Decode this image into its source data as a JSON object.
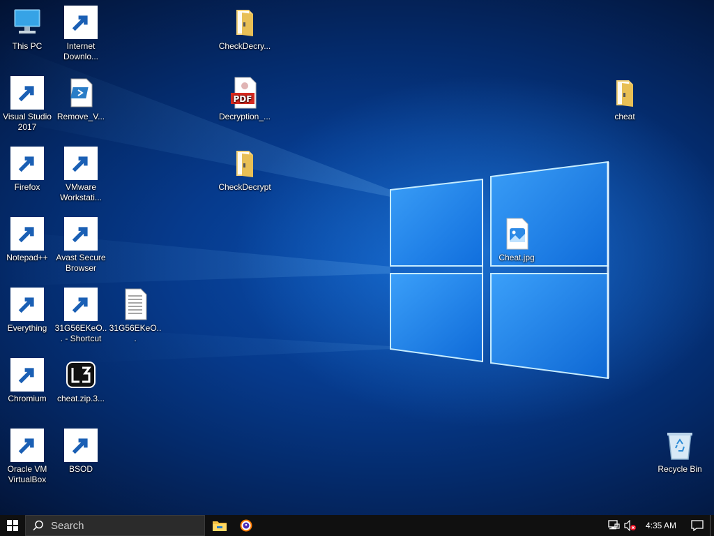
{
  "desktop_icons": [
    {
      "label": "This PC",
      "icon": "this-pc-icon"
    },
    {
      "label": "Internet Downlo...",
      "icon": "internet-download-manager-icon",
      "shortcut": true
    },
    {
      "label": "CheckDecry...",
      "icon": "folder-icon"
    },
    {
      "label": "Visual Studio 2017",
      "icon": "visual-studio-icon",
      "shortcut": true
    },
    {
      "label": "Remove_V...",
      "icon": "powershell-script-icon"
    },
    {
      "label": "Decryption_...",
      "icon": "pdf-icon",
      "badge": "PDF"
    },
    {
      "label": "cheat",
      "icon": "folder-icon"
    },
    {
      "label": "Firefox",
      "icon": "firefox-icon",
      "shortcut": true
    },
    {
      "label": "VMware Workstati...",
      "icon": "vmware-icon",
      "shortcut": true
    },
    {
      "label": "CheckDecrypt",
      "icon": "folder-icon"
    },
    {
      "label": "Notepad++",
      "icon": "notepad-plus-plus-icon",
      "shortcut": true
    },
    {
      "label": "Avast Secure Browser",
      "icon": "avast-browser-icon",
      "shortcut": true
    },
    {
      "label": "Cheat.jpg",
      "icon": "image-file-icon"
    },
    {
      "label": "Everything",
      "icon": "everything-search-icon",
      "shortcut": true
    },
    {
      "label": "31G56EKeO... - Shortcut",
      "icon": "text-document-icon",
      "shortcut": true
    },
    {
      "label": "31G56EKeO...",
      "icon": "text-document-icon"
    },
    {
      "label": "Chromium",
      "icon": "chromium-icon",
      "shortcut": true
    },
    {
      "label": "cheat.zip.3...",
      "icon": "archive-app-icon"
    },
    {
      "label": "Oracle VM VirtualBox",
      "icon": "virtualbox-icon",
      "shortcut": true
    },
    {
      "label": "BSOD",
      "icon": "document-shortcut-icon",
      "shortcut": true
    },
    {
      "label": "Recycle Bin",
      "icon": "recycle-bin-icon"
    }
  ],
  "taskbar": {
    "start_icon": "windows-start-icon",
    "search_placeholder": "Search",
    "pinned_apps": [
      {
        "icon": "file-explorer-icon"
      },
      {
        "icon": "avast-browser-icon"
      }
    ],
    "tray": {
      "network_icon": "network-icon",
      "volume_icon": "volume-muted-icon",
      "clock": "4:35 AM",
      "action_center_icon": "notification-icon"
    }
  },
  "colors": {
    "taskbar_bg": "#101010",
    "search_bg": "#2b2b2b",
    "wallpaper_accent": "#0a4fb0"
  }
}
